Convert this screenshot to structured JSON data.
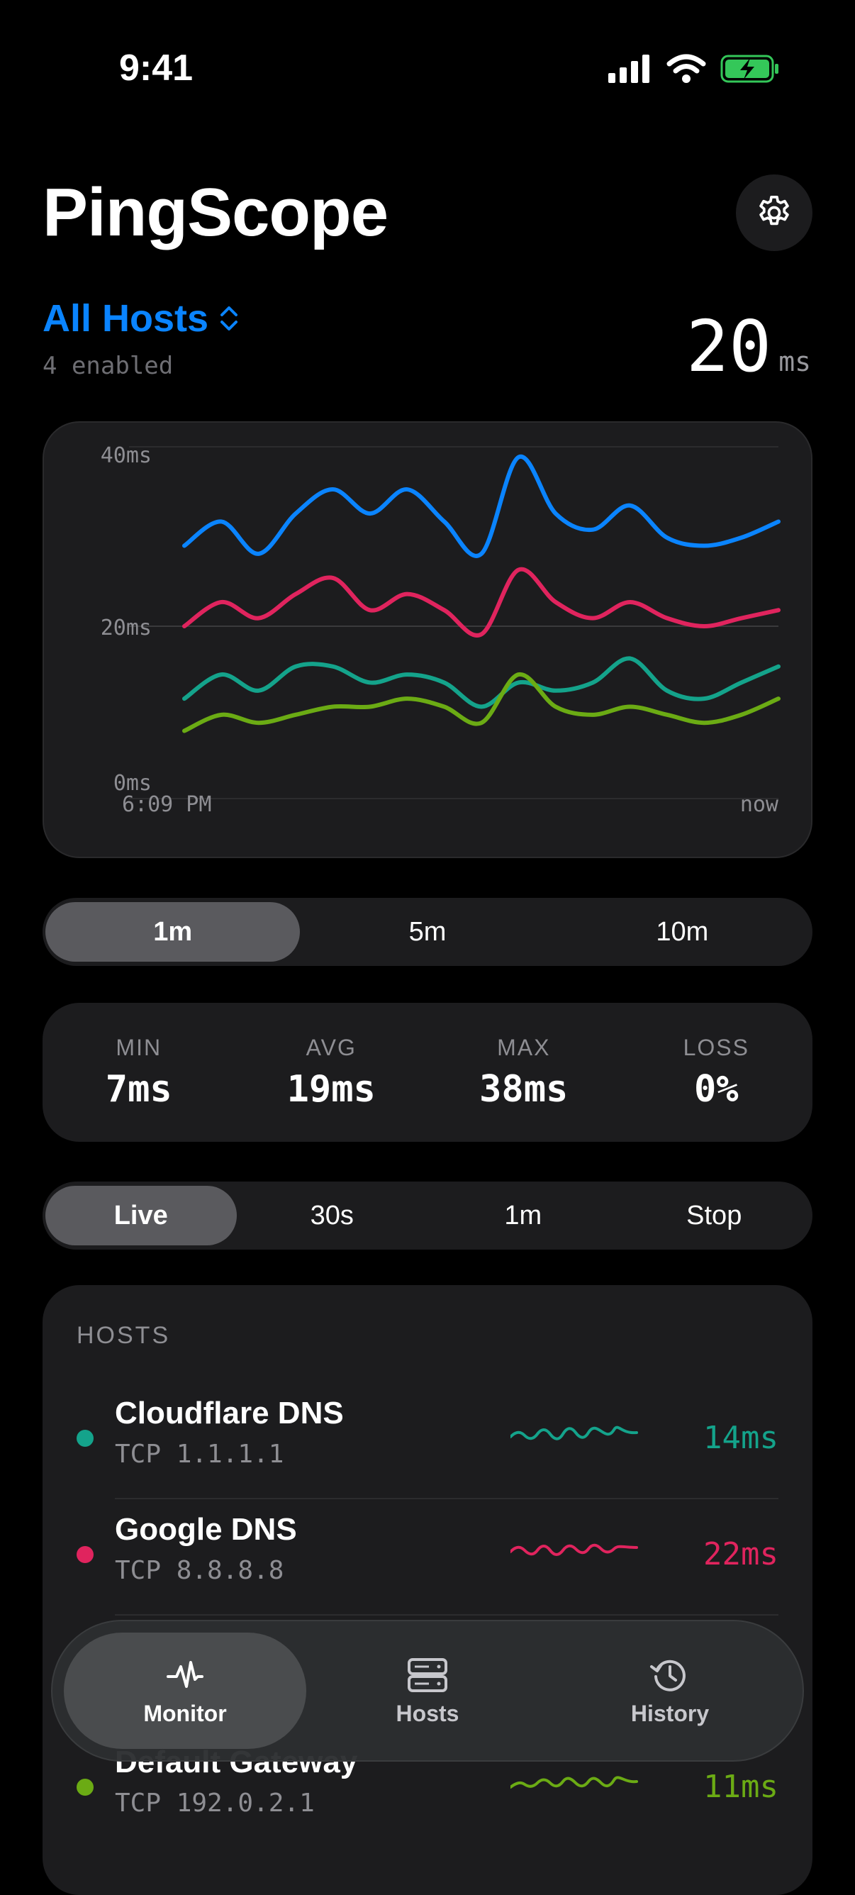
{
  "status_bar": {
    "time": "9:41"
  },
  "header": {
    "title": "PingScope",
    "settings_icon": "gear-icon"
  },
  "host_selector": {
    "label": "All Hosts",
    "subtitle": "4 enabled"
  },
  "current_latency": {
    "value": "20",
    "unit": "ms"
  },
  "chart_data": {
    "type": "line",
    "y_ticks": [
      "40ms",
      "20ms",
      "0ms"
    ],
    "x_tick_labels": [
      "6:09 PM",
      "now"
    ],
    "ylim": [
      0,
      40
    ],
    "grid": true,
    "series": [
      {
        "color": "#0a84ff",
        "values": [
          30,
          33,
          29,
          34,
          37,
          34,
          37,
          33,
          29,
          41,
          34,
          32,
          35,
          31,
          30,
          31,
          33
        ]
      },
      {
        "color": "#e0245e",
        "values": [
          20,
          23,
          21,
          24,
          26,
          22,
          24,
          22,
          19,
          27,
          23,
          21,
          23,
          21,
          20,
          21,
          22
        ]
      },
      {
        "color": "#14a38b",
        "values": [
          11,
          14,
          12,
          15,
          15,
          13,
          14,
          13,
          10,
          13,
          12,
          13,
          16,
          12,
          11,
          13,
          15
        ]
      },
      {
        "color": "#6bab14",
        "values": [
          7,
          9,
          8,
          9,
          10,
          10,
          11,
          10,
          8,
          14,
          10,
          9,
          10,
          9,
          8,
          9,
          11
        ]
      }
    ]
  },
  "chart_window": {
    "options": [
      "1m",
      "5m",
      "10m"
    ],
    "selected": "1m"
  },
  "stats": [
    {
      "label": "MIN",
      "value": "7ms"
    },
    {
      "label": "AVG",
      "value": "19ms"
    },
    {
      "label": "MAX",
      "value": "38ms"
    },
    {
      "label": "LOSS",
      "value": "0%"
    }
  ],
  "interval": {
    "options": [
      "Live",
      "30s",
      "1m",
      "Stop"
    ],
    "selected": "Live"
  },
  "hosts": {
    "header": "HOSTS",
    "items": [
      {
        "name": "Cloudflare DNS",
        "address": "TCP 1.1.1.1",
        "latency": "14ms",
        "color": "#14a38b"
      },
      {
        "name": "Google DNS",
        "address": "TCP 8.8.8.8",
        "latency": "22ms",
        "color": "#e0245e"
      },
      {
        "name": "",
        "address": "",
        "latency": "",
        "color": "#0a84ff"
      },
      {
        "name": "Default Gateway",
        "address": "TCP 192.0.2.1",
        "latency": "11ms",
        "color": "#6bab14"
      }
    ]
  },
  "tabbar": {
    "tabs": [
      {
        "label": "Monitor",
        "icon": "waveform-icon"
      },
      {
        "label": "Hosts",
        "icon": "server-icon"
      },
      {
        "label": "History",
        "icon": "history-icon"
      }
    ],
    "selected": "Monitor"
  }
}
